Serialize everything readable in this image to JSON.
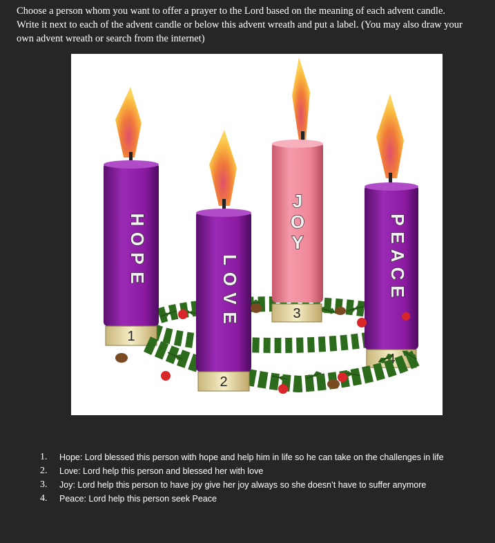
{
  "instructions": "Choose a person whom you want to offer a prayer to the Lord based on the meaning of each advent candle.  Write it next to each of the advent candle or below this advent wreath and put a label. (You may also draw your own advent wreath or search from the internet)",
  "candles": [
    {
      "label": "HOPE",
      "letters": [
        "H",
        "O",
        "P",
        "E"
      ],
      "number": "1",
      "color": "#8a1aa0"
    },
    {
      "label": "LOVE",
      "letters": [
        "L",
        "O",
        "V",
        "E"
      ],
      "number": "2",
      "color": "#8a1aa0"
    },
    {
      "label": "JOY",
      "letters": [
        "J",
        "O",
        "Y"
      ],
      "number": "3",
      "color": "#f08a9c"
    },
    {
      "label": "PEACE",
      "letters": [
        "P",
        "E",
        "A",
        "C",
        "E"
      ],
      "number": "4",
      "color": "#8a1aa0"
    }
  ],
  "prayers": [
    {
      "number": "1.",
      "text": "Hope: Lord blessed this person with hope and help him in life so he can take on the challenges in life"
    },
    {
      "number": "2.",
      "text": "Love: Lord help this person and blessed her with love"
    },
    {
      "number": "3.",
      "text": "Joy: Lord help this person to have joy give her joy always so she doesn’t have to suffer anymore"
    },
    {
      "number": "4.",
      "text": "Peace: Lord help this person seek Peace"
    }
  ],
  "colors": {
    "background": "#262626",
    "purple": "#8a1aa0",
    "pink": "#f08a9c",
    "greenery": "#2f6b1f",
    "berries": "#d8262b",
    "plates": "#efe3b0"
  }
}
